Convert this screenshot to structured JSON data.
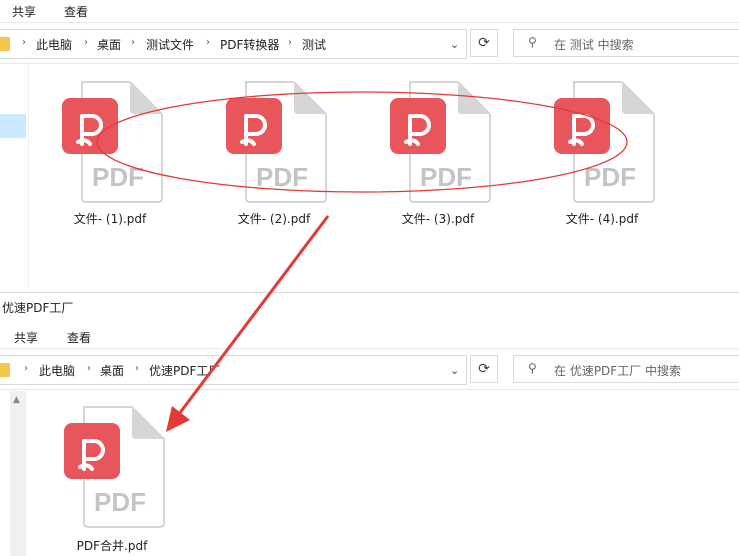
{
  "window1": {
    "ribbon": {
      "share": "共享",
      "view": "查看"
    },
    "breadcrumb": [
      "此电脑",
      "桌面",
      "测试文件",
      "PDF转换器",
      "测试"
    ],
    "search_placeholder": "在 测试 中搜索",
    "files": [
      {
        "name": "文件- (1).pdf"
      },
      {
        "name": "文件- (2).pdf"
      },
      {
        "name": "文件- (3).pdf"
      },
      {
        "name": "文件- (4).pdf"
      }
    ]
  },
  "window2": {
    "title": "优速PDF工厂",
    "ribbon": {
      "share": "共享",
      "view": "查看"
    },
    "breadcrumb": [
      "此电脑",
      "桌面",
      "优速PDF工厂"
    ],
    "search_placeholder": "在 优速PDF工厂 中搜索",
    "files": [
      {
        "name": "PDF合并.pdf"
      }
    ]
  },
  "icons": {
    "pdf_badge_text": "PDF",
    "refresh": "⟳",
    "chevron_down": "⌄",
    "breadcrumb_sep": "›",
    "search": "⚲"
  },
  "colors": {
    "pdf_red": "#e8555a",
    "annotation_red": "#e53935",
    "selection_blue": "#cce8ff",
    "folder_yellow": "#f3c64c"
  }
}
